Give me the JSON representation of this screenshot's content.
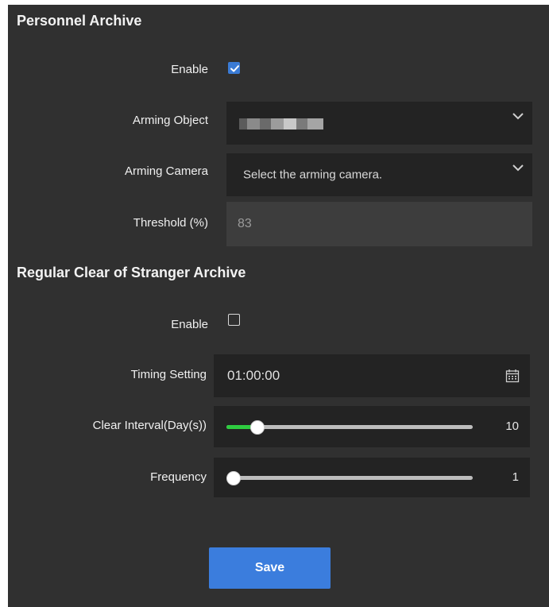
{
  "personnel_archive": {
    "title": "Personnel Archive",
    "enable_label": "Enable",
    "enable_checked": true,
    "arming_object_label": "Arming Object",
    "arming_object_value": "",
    "arming_camera_label": "Arming Camera",
    "arming_camera_placeholder": "Select the arming camera.",
    "threshold_label": "Threshold (%)",
    "threshold_value": "83"
  },
  "stranger_archive": {
    "title": "Regular Clear of Stranger Archive",
    "enable_label": "Enable",
    "enable_checked": false,
    "timing_label": "Timing  Setting",
    "timing_value": "01:00:00",
    "clear_interval_label": "Clear Interval(Day(s))",
    "clear_interval_value": "10",
    "clear_interval_fraction": 0.06,
    "frequency_label": "Frequency",
    "frequency_value": "1",
    "frequency_fraction": 0.0
  },
  "save_label": "Save",
  "colors": {
    "panel_bg": "#303030",
    "field_bg": "#232323",
    "accent": "#3b7ddd",
    "slider_fill": "#2ecc40"
  },
  "icons": [
    "checkbox-checked-icon",
    "checkbox-unchecked-icon",
    "chevron-down-icon",
    "calendar-icon",
    "slider-thumb"
  ]
}
